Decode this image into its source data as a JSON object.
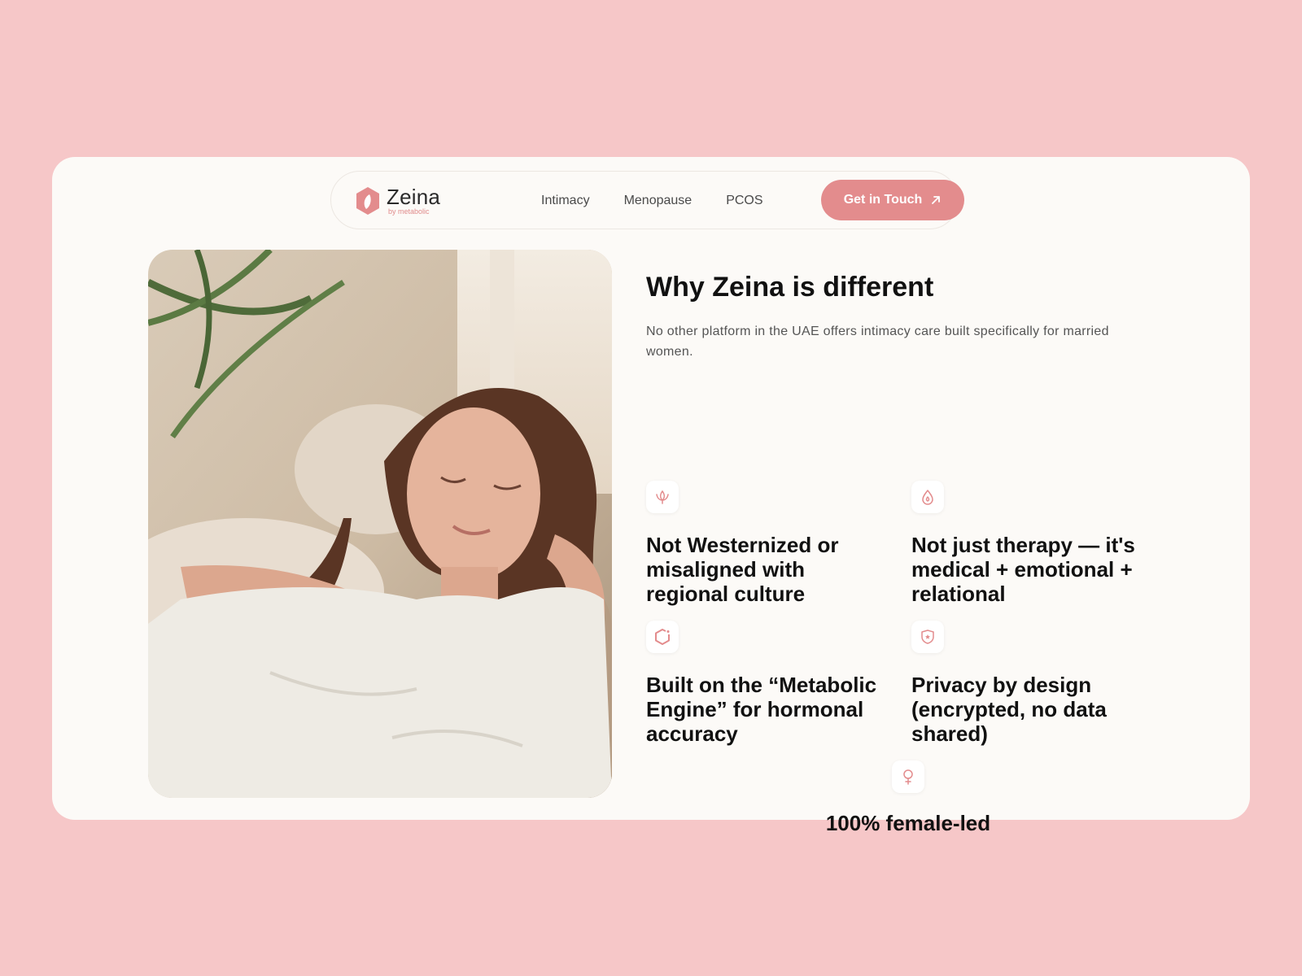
{
  "colors": {
    "background": "#f6c7c8",
    "card": "#fcfaf7",
    "accent": "#e38c8d"
  },
  "brand": {
    "name": "Zeina",
    "sub": "by metabolic"
  },
  "nav": {
    "links": [
      "Intimacy",
      "Menopause",
      "PCOS"
    ],
    "cta": "Get in Touch"
  },
  "hero_image": {
    "alt": "Woman relaxing on a sofa with eyes closed"
  },
  "section": {
    "title": "Why Zeina is different",
    "subtitle": "No other platform in the UAE offers intimacy care built specifically for married women."
  },
  "features": [
    {
      "icon": "lotus-icon",
      "text": "Not Westernized or misaligned with regional culture"
    },
    {
      "icon": "flame-icon",
      "text": "Not just therapy — it's medical + emotional + relational"
    },
    {
      "icon": "hexagon-icon",
      "text": "Built on the “Metabolic Engine” for hormonal accuracy"
    },
    {
      "icon": "shield-icon",
      "text": "Privacy by design (encrypted, no data shared)"
    },
    {
      "icon": "female-icon",
      "text": "100% female-led"
    }
  ]
}
